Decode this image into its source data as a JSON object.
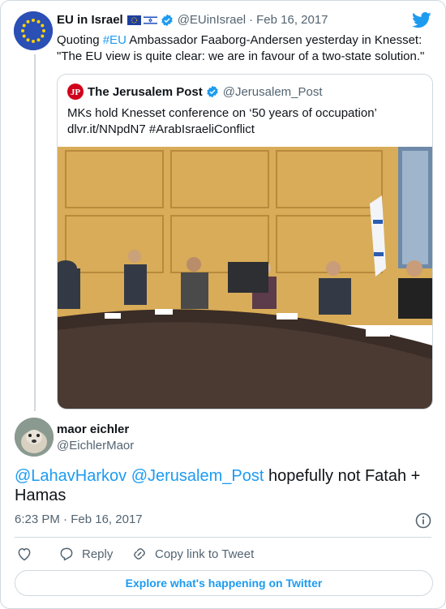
{
  "quoted_tweet": {
    "author_name": "EU in Israel",
    "handle": "@EUinIsrael",
    "separator": "·",
    "date": "Feb 16, 2017",
    "text_prefix": "Quoting ",
    "hashtag": "#EU",
    "text_line1_rest": " Ambassador Faaborg-Andersen yesterday in Knesset:",
    "text_line2": "\"The EU view is quite clear: we are in favour of a two-state  solution.\"",
    "flags": [
      "EU flag",
      "Israel flag"
    ]
  },
  "embedded_tweet": {
    "author_name": "The Jerusalem Post",
    "handle": "@Jerusalem_Post",
    "logo_text": "JPost",
    "text_line1": "MKs hold Knesset conference on ‘50 years of occupation’",
    "link": "dlvr.it/NNpdN7",
    "hashtag": "#ArabIsraeliConflict"
  },
  "reply_tweet": {
    "author_name": "maor eichler",
    "handle": "@EichlerMaor",
    "mention1": "@LahavHarkov",
    "mention2": "@Jerusalem_Post",
    "text_rest": " hopefully not Fatah +",
    "text_line2": "Hamas",
    "time": "6:23 PM",
    "separator": "·",
    "date": "Feb 16, 2017"
  },
  "actions": {
    "reply_label": "Reply",
    "copy_label": "Copy link to Tweet",
    "explore_label": "Explore what's happening on Twitter"
  },
  "icons": [
    "twitter-bird-icon",
    "verified-badge-icon",
    "info-icon",
    "heart-icon",
    "reply-icon",
    "link-icon"
  ],
  "colors": {
    "accent": "#1d9bf0",
    "secondary_text": "#536471",
    "border": "#cfd9de",
    "jpost_red": "#d0021b"
  }
}
